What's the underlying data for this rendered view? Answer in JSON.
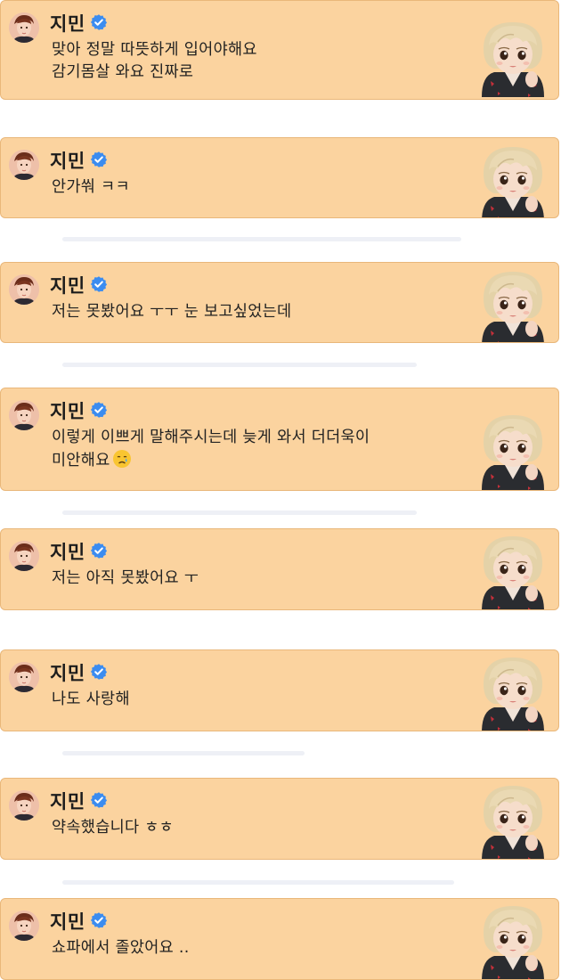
{
  "user": {
    "name": "지민",
    "verified_icon": "verified-badge-icon",
    "avatar_icon": "profile-photo"
  },
  "colors": {
    "card_bg": "#fbd39f",
    "card_border": "#e9b77a",
    "verified_blue": "#3b8cf0"
  },
  "messages": [
    {
      "text": "맞아 정말 따뜻하게 입어야해요\n감기몸살 와요 진짜로"
    },
    {
      "text": "안가쒀 ㅋㅋ"
    },
    {
      "text": "저는 못봤어요 ㅜㅜ 눈 보고싶었는데"
    },
    {
      "text": "이렇게 이쁘게 말해주시는데 늦게 와서 더더욱이\n미안해요",
      "emoji": "crying-face-emoji"
    },
    {
      "text": "저는 아직 못봤어요 ㅜ"
    },
    {
      "text": "나도 사랑해"
    },
    {
      "text": "약속했습니다 ㅎㅎ"
    },
    {
      "text": "쇼파에서 졸았어요 .."
    }
  ]
}
